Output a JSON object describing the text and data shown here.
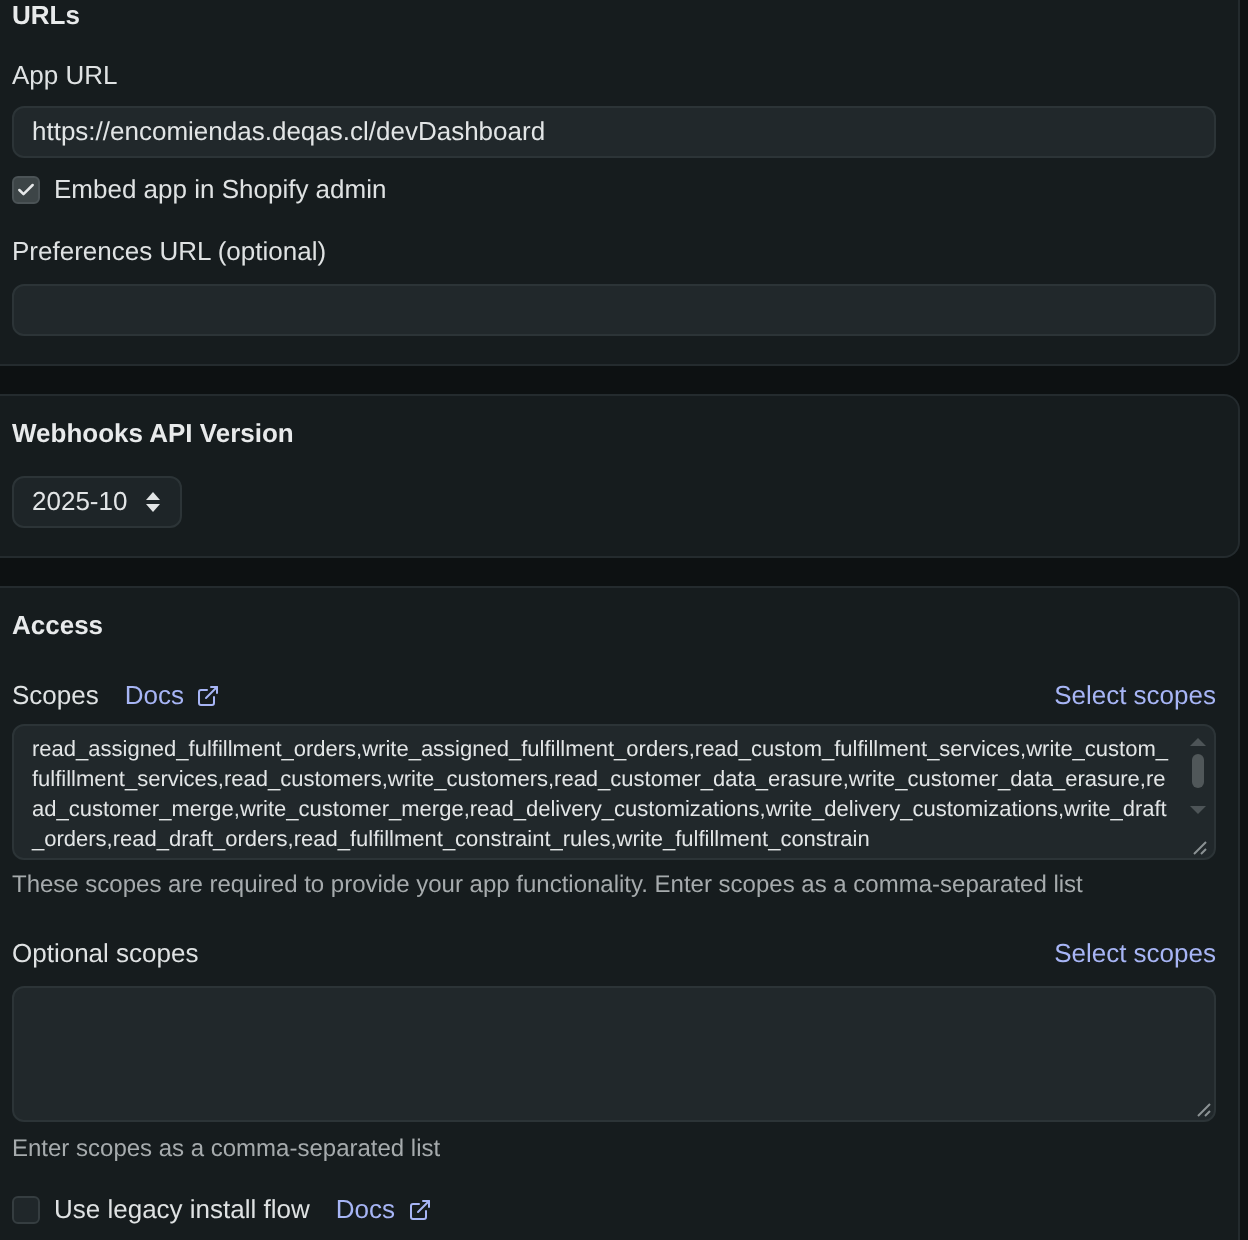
{
  "urls": {
    "title": "URLs",
    "app_url": {
      "label": "App URL",
      "value": "https://encomiendas.deqas.cl/devDashboard"
    },
    "embed": {
      "label": "Embed app in Shopify admin",
      "checked": true
    },
    "preferences_url": {
      "label": "Preferences URL (optional)"
    }
  },
  "webhooks": {
    "title": "Webhooks API Version",
    "version": {
      "value": "2025-10"
    }
  },
  "access": {
    "title": "Access",
    "scopes": {
      "label": "Scopes",
      "docs_link": "Docs",
      "select_link": "Select scopes",
      "value": "read_assigned_fulfillment_orders,write_assigned_fulfillment_orders,read_custom_fulfillment_services,write_custom_fulfillment_services,read_customers,write_customers,read_customer_data_erasure,write_customer_data_erasure,read_customer_merge,write_customer_merge,read_delivery_customizations,write_delivery_customizations,write_draft_orders,read_draft_orders,read_fulfillment_constraint_rules,write_fulfillment_constrain",
      "help": "These scopes are required to provide your app functionality. Enter scopes as a comma-separated list"
    },
    "optional_scopes": {
      "label": "Optional scopes",
      "select_link": "Select scopes",
      "help": "Enter scopes as a comma-separated list"
    },
    "legacy_install": {
      "label": "Use legacy install flow",
      "checked": false,
      "docs_link": "Docs"
    }
  }
}
